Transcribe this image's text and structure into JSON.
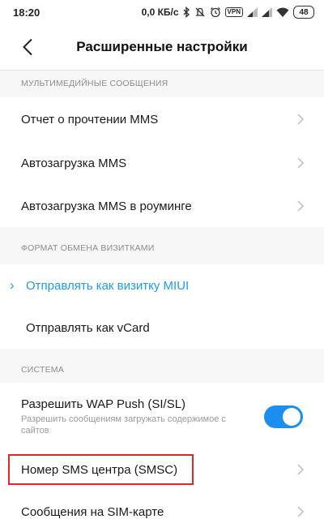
{
  "status_bar": {
    "time": "18:20",
    "speed": "0,0 КБ/с",
    "vpn_label": "VPN",
    "battery": "48"
  },
  "header": {
    "title": "Расширенные настройки",
    "back_icon": "chevron-left-icon"
  },
  "sections": {
    "mms": {
      "header": "МУЛЬТИМЕДИЙНЫЕ СООБЩЕНИЯ",
      "items": [
        {
          "label": "Отчет о прочтении MMS"
        },
        {
          "label": "Автозагрузка MMS"
        },
        {
          "label": "Автозагрузка MMS в роуминге"
        }
      ]
    },
    "vcard": {
      "header": "ФОРМАТ ОБМЕНА ВИЗИТКАМИ",
      "options": [
        {
          "label": "Отправлять как визитку MIUI",
          "selected": true
        },
        {
          "label": "Отправлять как vCard",
          "selected": false
        }
      ]
    },
    "system": {
      "header": "СИСТЕМА",
      "wap_push": {
        "title": "Разрешить WAP Push (SI/SL)",
        "description": "Разрешить сообщениям загружать содержимое с сайтов",
        "enabled": true
      },
      "items": [
        {
          "label": "Номер SMS центра (SMSC)"
        },
        {
          "label": "Сообщения на SIM-карте"
        }
      ]
    }
  },
  "colors": {
    "accent": "#1a9cf0",
    "toggle_on": "#1a8ff0",
    "highlight": "#e0262b"
  }
}
